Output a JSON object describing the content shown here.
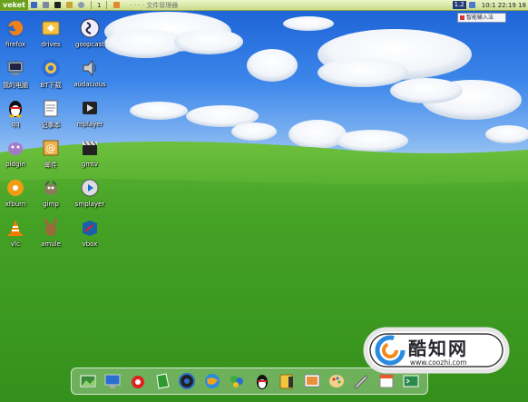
{
  "top_panel": {
    "logo": "veket",
    "workspace_number": "1",
    "task_title": "· · · · 文件管理器",
    "language_indicator": "1.2",
    "clock": "10:1 22:19 18"
  },
  "ime_box": {
    "label": "智能输入法"
  },
  "desktop_icons": [
    {
      "label": "firefox"
    },
    {
      "label": "drives"
    },
    {
      "label": "goopcast"
    },
    {
      "label": "我的电脑"
    },
    {
      "label": "BT下载"
    },
    {
      "label": "audacious"
    },
    {
      "label": "qq"
    },
    {
      "label": "记事本"
    },
    {
      "label": "mplayer"
    },
    {
      "label": "pidgin"
    },
    {
      "label": "邮件"
    },
    {
      "label": "gmtv"
    },
    {
      "label": "xfburn"
    },
    {
      "label": "gimp"
    },
    {
      "label": "smplayer"
    },
    {
      "label": "vlc"
    },
    {
      "label": "amule"
    },
    {
      "label": "vbox"
    }
  ],
  "dock": {
    "items": [
      "image-viewer",
      "monitor",
      "package-manager",
      "notes",
      "media-player",
      "web-browser",
      "chat",
      "qq-penguin",
      "file-manager",
      "image-editor",
      "palette",
      "pen-tool",
      "calendar",
      "terminal"
    ]
  },
  "watermark": {
    "name": "酷知网",
    "url": "www.coozhi.com"
  }
}
